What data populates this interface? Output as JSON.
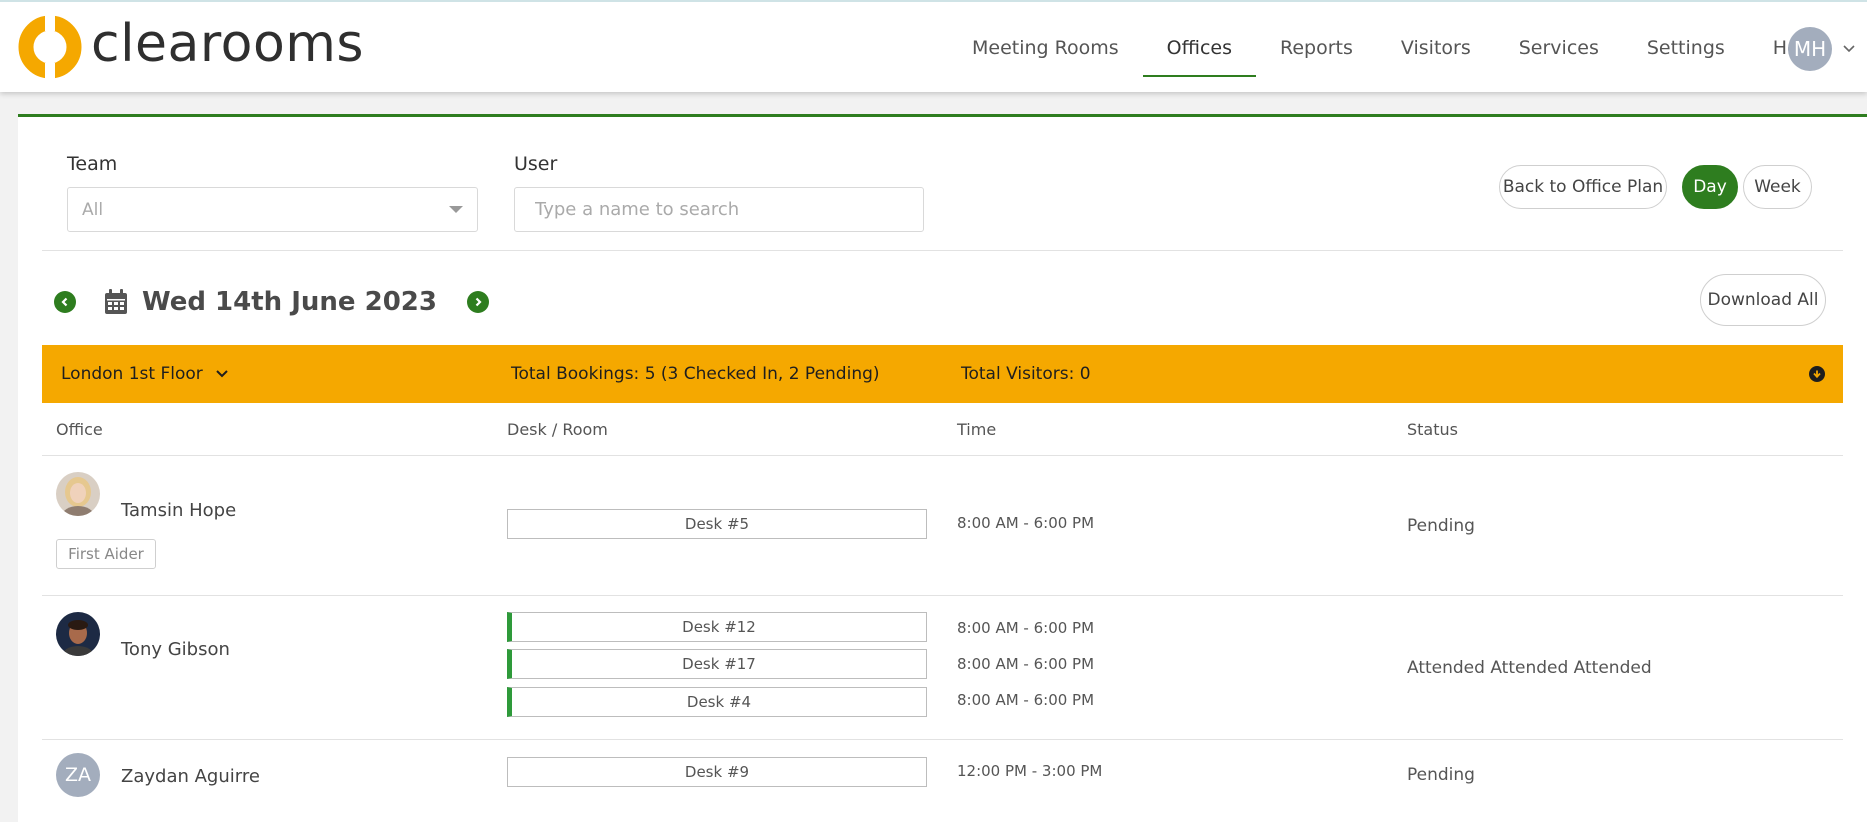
{
  "app": {
    "logo_text": "clearooms",
    "brand_orange": "#f5a800",
    "brand_green": "#2e7d1f"
  },
  "nav": {
    "items": [
      "Meeting Rooms",
      "Offices",
      "Reports",
      "Visitors",
      "Services",
      "Settings",
      "Help"
    ],
    "active": "Offices",
    "user_initials": "MH"
  },
  "filters": {
    "team_label": "Team",
    "team_value": "All",
    "user_label": "User",
    "user_placeholder": "Type a name to search"
  },
  "actions": {
    "back_label": "Back to Office Plan",
    "day_label": "Day",
    "week_label": "Week",
    "download_label": "Download All",
    "view_mode": "Day"
  },
  "date": {
    "label": "Wed 14th June 2023"
  },
  "summary": {
    "location": "London 1st Floor",
    "total_bookings": "Total Bookings: 5 (3 Checked In, 2 Pending)",
    "total_visitors": "Total Visitors: 0"
  },
  "table": {
    "columns": [
      "Office",
      "Desk / Room",
      "Time",
      "Status"
    ],
    "rows": [
      {
        "name": "Tamsin Hope",
        "badge": "First Aider",
        "avatar_initials": "",
        "desks": [
          "Desk #5"
        ],
        "times": [
          "8:00 AM - 6:00 PM"
        ],
        "status": "Pending"
      },
      {
        "name": "Tony Gibson",
        "badge": "",
        "avatar_initials": "",
        "desks": [
          "Desk #12",
          "Desk #17",
          "Desk #4"
        ],
        "times": [
          "8:00 AM - 6:00 PM",
          "8:00 AM - 6:00 PM",
          "8:00 AM - 6:00 PM"
        ],
        "status": "Attended Attended Attended"
      },
      {
        "name": "Zaydan Aguirre",
        "badge": "",
        "avatar_initials": "ZA",
        "desks": [
          "Desk #9"
        ],
        "times": [
          "12:00 PM - 3:00 PM"
        ],
        "status": "Pending"
      }
    ]
  }
}
